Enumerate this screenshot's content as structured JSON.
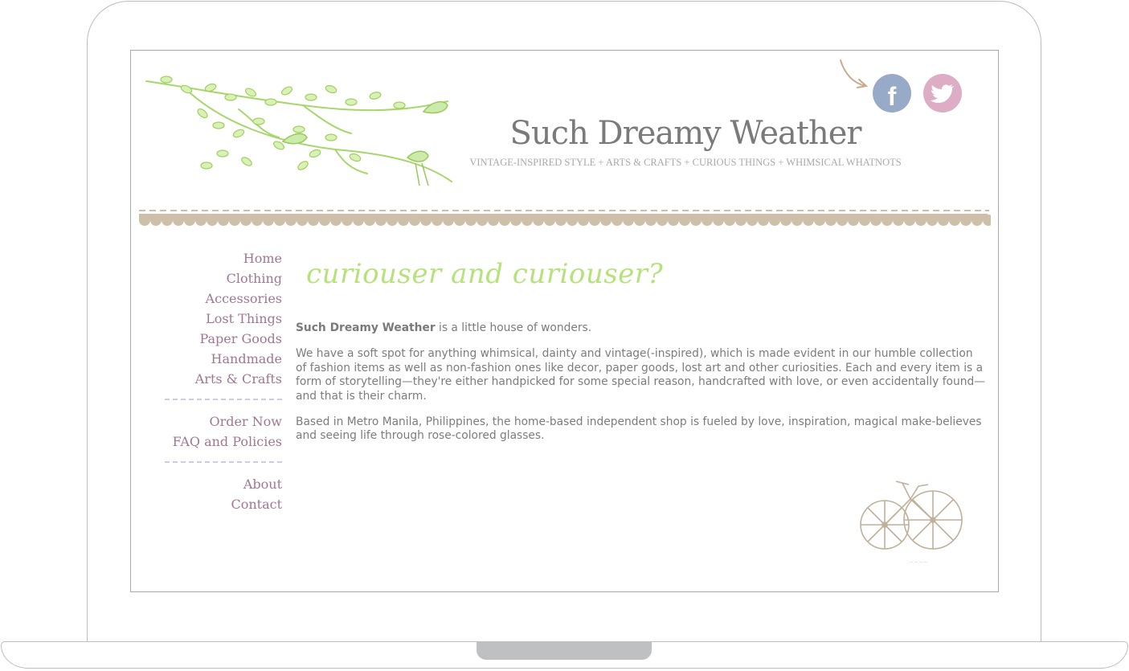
{
  "site": {
    "title": "Such Dreamy Weather",
    "tagline": "VINTAGE-INSPIRED STYLE + ARTS & CRAFTS + CURIOUS THINGS + WHIMSICAL WHATNOTS"
  },
  "social": [
    {
      "name": "facebook-icon",
      "glyph": "f",
      "color": "#97aac7"
    },
    {
      "name": "twitter-icon",
      "color": "#dcadc4"
    }
  ],
  "nav": {
    "group1": [
      "Home",
      "Clothing",
      "Accessories",
      "Lost Things",
      "Paper Goods",
      "Handmade",
      "Arts & Crafts"
    ],
    "group2": [
      "Order Now",
      "FAQ and Policies"
    ],
    "group3": [
      "About",
      "Contact"
    ]
  },
  "main": {
    "heading": "curiouser and curiouser?",
    "intro_bold": "Such Dreamy Weather",
    "intro_rest": " is a little house of wonders.",
    "paragraph2": "We have a soft spot for anything whimsical, dainty and vintage(-inspired), which is made evident in our humble collection of fashion items as well as non-fashion ones like decor, paper goods, lost art and other curiosities. Each and every item is a form of storytelling—they're either handpicked for some special reason, handcrafted with love, or even accidentally found—and that is their charm.",
    "paragraph3": "Based in Metro Manila, Philippines, the home-based independent shop is fueled by love, inspiration, magical make-believes and seeing life through rose-colored glasses."
  },
  "colors": {
    "nav_link": "#a07792",
    "heading": "#b6e27c",
    "scallop": "#cdbfa9",
    "title": "#7a7a7a"
  }
}
